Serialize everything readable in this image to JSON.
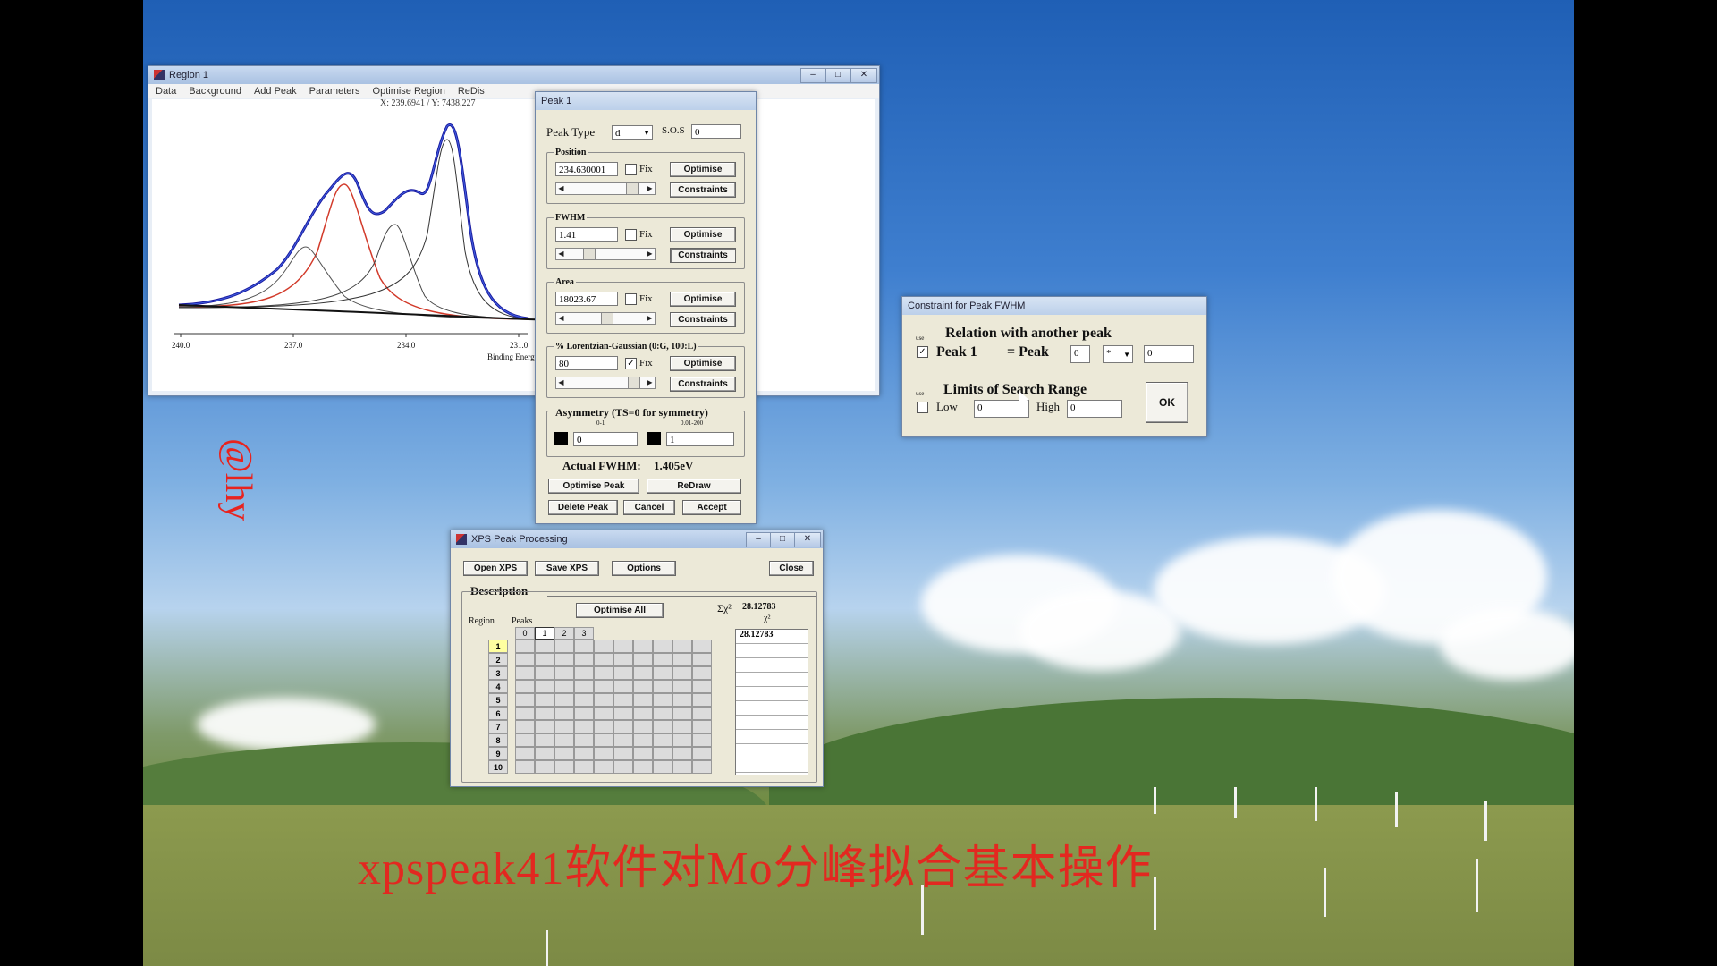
{
  "region_window": {
    "title": "Region 1",
    "menu": [
      "Data",
      "Background",
      "Add Peak",
      "Parameters",
      "Optimise Region",
      "ReDis"
    ],
    "cursor_readout": "X: 239.6941 / Y: 7438.227",
    "x_ticks": [
      "240.0",
      "237.0",
      "234.0",
      "231.0"
    ],
    "x_label": "Binding Energy"
  },
  "peak_window": {
    "title": "Peak 1",
    "peak_type_label": "Peak Type",
    "peak_type_value": "d",
    "sos_label": "S.O.S",
    "sos_value": "0",
    "position_label": "Position",
    "position_value": "234.630001",
    "fwhm_label": "FWHM",
    "fwhm_value": "1.41",
    "area_label": "Area",
    "area_value": "18023.67",
    "lg_label": "% Lorentzian-Gaussian (0:G, 100:L)",
    "lg_value": "80",
    "fix_label": "Fix",
    "optimise_label": "Optimise",
    "constraints_label": "Constraints",
    "asym_label": "Asymmetry (TS=0 for symmetry)",
    "asym_range1": "0-1",
    "asym_range2": "0.01-200",
    "asym_val1": "0",
    "asym_val2": "1",
    "actual_fwhm_label": "Actual FWHM:",
    "actual_fwhm_value": "1.405eV",
    "optimise_peak": "Optimise Peak",
    "redraw": "ReDraw",
    "delete_peak": "Delete Peak",
    "cancel": "Cancel",
    "accept": "Accept"
  },
  "constraint_window": {
    "title": "Constraint for Peak FWHM",
    "use_label": "use",
    "relation_heading": "Relation with another peak",
    "peak_label": "Peak 1",
    "equals_peak": "= Peak",
    "peak_num": "0",
    "operator": "*",
    "factor": "0",
    "limits_heading": "Limits of Search Range",
    "low_label": "Low",
    "low_value": "0",
    "high_label": "High",
    "high_value": "0",
    "ok": "OK"
  },
  "xps_window": {
    "title": "XPS Peak Processing",
    "open_xps": "Open XPS",
    "save_xps": "Save XPS",
    "options": "Options",
    "close": "Close",
    "description_label": "Description",
    "optimise_all": "Optimise All",
    "sum_chi_label": "Σχ²",
    "sum_chi_value": "28.12783",
    "chi_label": "χ²",
    "chi_first": "28.12783",
    "region_header": "Region",
    "peaks_header": "Peaks",
    "peak_cols": [
      "0",
      "1",
      "2",
      "3"
    ],
    "regions": [
      "1",
      "2",
      "3",
      "4",
      "5",
      "6",
      "7",
      "8",
      "9",
      "10"
    ]
  },
  "overlay": {
    "watermark": "@lhy",
    "caption": "xpspeak41软件对Mo分峰拟合基本操作"
  }
}
